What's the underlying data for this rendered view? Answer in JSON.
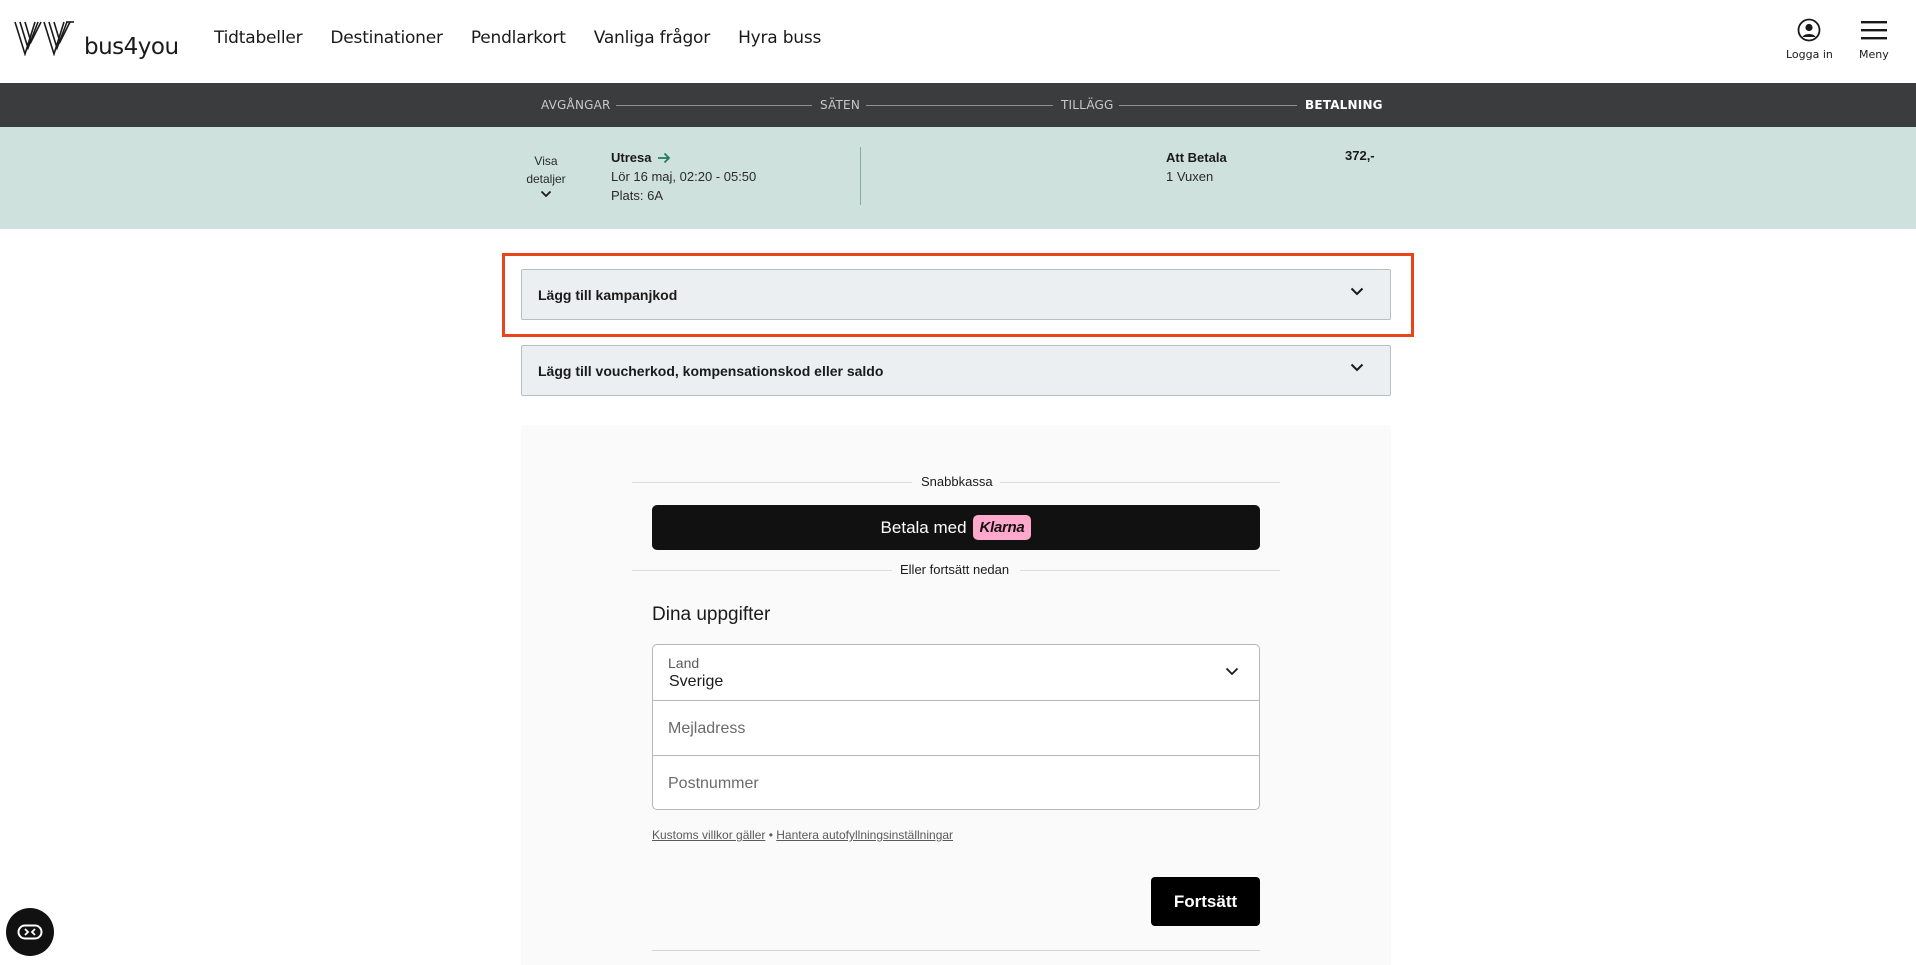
{
  "brand": {
    "name": "bus4you",
    "logo_icon": "vy-logo-icon"
  },
  "nav": {
    "items": [
      "Tidtabeller",
      "Destinationer",
      "Pendlarkort",
      "Vanliga frågor",
      "Hyra buss"
    ]
  },
  "header_actions": {
    "login_label": "Logga in",
    "login_icon": "user-circle-icon",
    "menu_label": "Meny",
    "menu_icon": "hamburger-icon"
  },
  "progress": {
    "steps": [
      "AVGÅNGAR",
      "SÄTEN",
      "TILLÄGG",
      "BETALNING"
    ],
    "active_step": "BETALNING"
  },
  "summary": {
    "details_toggle": "Visa detaljer",
    "details_line1": "Visa",
    "details_line2": "detaljer",
    "trip_title": "Utresa",
    "trip_date": "Lör 16 maj, 02:20 - 05:50",
    "trip_seat": "Plats: 6A",
    "pay_title": "Att Betala",
    "pay_passengers": "1 Vuxen",
    "amount": "372,-"
  },
  "accordions": {
    "campaign": "Lägg till kampanjkod",
    "voucher": "Lägg till voucherkod, kompensationskod eller saldo"
  },
  "checkout": {
    "express_label": "Snabbkassa",
    "klarna_prefix": "Betala med",
    "klarna_brand": "Klarna",
    "or_continue": "Eller fortsätt nedan",
    "section_title": "Dina uppgifter",
    "country_label": "Land",
    "country_value": "Sverige",
    "email_placeholder": "Mejladress",
    "postal_placeholder": "Postnummer",
    "terms_link": "Kustoms villkor gäller",
    "link_separator": "•",
    "autofill_link": "Hantera autofyllningsinställningar",
    "continue_button": "Fortsätt"
  },
  "colors": {
    "highlight": "#e8461a",
    "progress_bg": "#3a3c3e",
    "summary_bg": "#cfe1dc",
    "klarna_pink": "#ffa8cd"
  }
}
